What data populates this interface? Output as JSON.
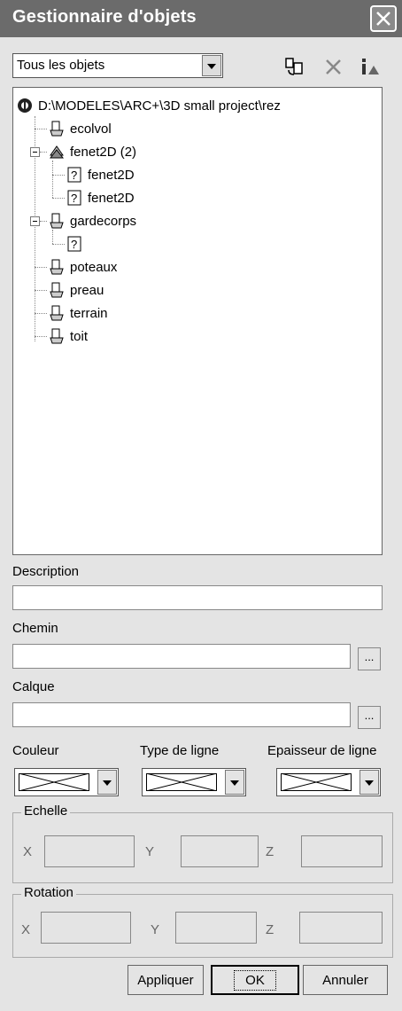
{
  "window": {
    "title": "Gestionnaire d'objets"
  },
  "filter": {
    "selected": "Tous les objets"
  },
  "toolbar": {
    "icons": [
      "replace-icon",
      "delete-icon",
      "info-icon"
    ]
  },
  "tree": {
    "root": "D:\\MODELES\\ARC+\\3D small project\\rez",
    "items": [
      {
        "label": "ecolvol"
      },
      {
        "label": "fenet2D (2)"
      },
      {
        "label": "fenet2D"
      },
      {
        "label": "fenet2D"
      },
      {
        "label": "gardecorps"
      },
      {
        "label": ""
      },
      {
        "label": "poteaux"
      },
      {
        "label": "preau"
      },
      {
        "label": "terrain"
      },
      {
        "label": "toit"
      }
    ]
  },
  "form": {
    "description_label": "Description",
    "description_value": "",
    "chemin_label": "Chemin",
    "chemin_value": "",
    "chemin_browse": "...",
    "calque_label": "Calque",
    "calque_value": "",
    "calque_browse": "...",
    "couleur_label": "Couleur",
    "type_label": "Type de ligne",
    "epaisseur_label": "Epaisseur de ligne"
  },
  "echelle": {
    "legend": "Echelle",
    "x": "X",
    "y": "Y",
    "z": "Z"
  },
  "rotation": {
    "legend": "Rotation",
    "x": "X",
    "y": "Y",
    "z": "Z"
  },
  "buttons": {
    "apply": "Appliquer",
    "ok": "OK",
    "cancel": "Annuler"
  }
}
